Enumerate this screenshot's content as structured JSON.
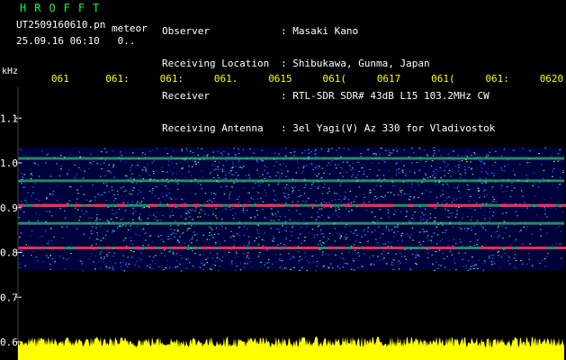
{
  "colors": {
    "title": "#00ff40",
    "header_text": "#ffffff",
    "time_labels": "#ffff00",
    "axis_labels": "#ffffff",
    "background": "#000000",
    "waterfall": "#00003c",
    "echo_red": "#ff2a55",
    "echo_green": "#40ff80",
    "amplitude": "#ffff00"
  },
  "header": {
    "title": "HROFFT",
    "filename": "UT2509160610.pn",
    "mode": "meteor",
    "timestamp": "25.09.16 06:10   0..",
    "info_labels": [
      "Observer",
      "Receiving Location",
      "Receiver",
      "Receiving Antenna"
    ],
    "info_values": [
      ": Masaki Kano",
      ": Shibukawa, Gunma, Japan",
      ": RTL-SDR SDR# 43dB L15 103.2MHz CW",
      ": 3el Yagi(V) Az 330 for Vladivostok"
    ]
  },
  "chart_data": {
    "type": "heatmap",
    "ylabel": "kHz",
    "y_ticks": [
      "1.1",
      "1.0",
      "0.9",
      "0.8",
      "0.7",
      "0.6"
    ],
    "y_tick_values": [
      1.1,
      1.0,
      0.9,
      0.8,
      0.7,
      0.6
    ],
    "ylim": [
      0.58,
      1.2
    ],
    "time_labels": [
      "061",
      "061:",
      "061:",
      "061.",
      "0615",
      "061(",
      "0617",
      "061(",
      "061:",
      "0620"
    ],
    "echo_bands_khz": [
      1.01,
      0.96,
      0.905,
      0.865,
      0.81
    ],
    "signal_end_khz": 0.76
  }
}
